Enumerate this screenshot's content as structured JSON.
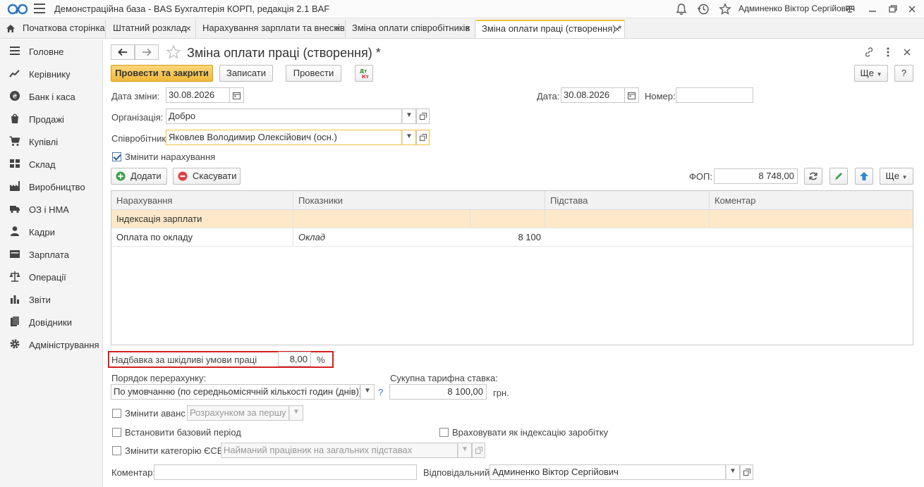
{
  "app": {
    "title": "Демонстраційна база - BAS Бухгалтерія КОРП, редакція 2.1 BAF",
    "user": "Админенко Віктор Сергійович"
  },
  "tabs": [
    {
      "label": "Початкова сторінка"
    },
    {
      "label": "Штатний розклад"
    },
    {
      "label": "Нарахування зарплати та внесків"
    },
    {
      "label": "Зміна оплати співробітників"
    },
    {
      "label": "Зміна оплати праці (створення) *"
    }
  ],
  "sidebar": {
    "items": [
      {
        "label": "Головне",
        "icon": "menu-icon"
      },
      {
        "label": "Керівнику",
        "icon": "trend-icon"
      },
      {
        "label": "Банк і каса",
        "icon": "coin-icon"
      },
      {
        "label": "Продажі",
        "icon": "bag-icon"
      },
      {
        "label": "Купівлі",
        "icon": "cart-icon"
      },
      {
        "label": "Склад",
        "icon": "warehouse-icon"
      },
      {
        "label": "Виробництво",
        "icon": "factory-icon"
      },
      {
        "label": "ОЗ і НМА",
        "icon": "truck-icon"
      },
      {
        "label": "Кадри",
        "icon": "person-icon"
      },
      {
        "label": "Зарплата",
        "icon": "wallet-icon"
      },
      {
        "label": "Операції",
        "icon": "scales-icon"
      },
      {
        "label": "Звіти",
        "icon": "bar-chart-icon"
      },
      {
        "label": "Довідники",
        "icon": "books-icon"
      },
      {
        "label": "Адміністрування",
        "icon": "gear-icon"
      }
    ]
  },
  "form": {
    "title": "Зміна оплати праці (створення) *",
    "buttons": {
      "post_close": "Провести та закрити",
      "save": "Записати",
      "post": "Провести",
      "more": "Ще",
      "help": "?"
    },
    "change_date_label": "Дата зміни:",
    "change_date": "30.08.2026",
    "date_label": "Дата:",
    "date": "30.08.2026",
    "number_label": "Номер:",
    "number": "",
    "org_label": "Організація:",
    "org": "Добро",
    "employee_label": "Співробітник:",
    "employee": "Яковлев Володимир Олексійович (осн.)",
    "change_accruals_label": "Змінити нарахування",
    "add_label": "Додати",
    "cancel_label": "Скасувати",
    "fop_label": "ФОП:",
    "fop": "8 748,00",
    "grid_more": "Ще"
  },
  "grid": {
    "columns": [
      "Нарахування",
      "Показники",
      "Підстава",
      "Коментар"
    ],
    "rows": [
      {
        "accrual": "Індексація зарплати",
        "indicator": "",
        "value": "",
        "basis": "",
        "comment": ""
      },
      {
        "accrual": "Оплата по окладу",
        "indicator": "Оклад",
        "value": "8 100",
        "basis": "",
        "comment": ""
      }
    ]
  },
  "bottom": {
    "hazard_label": "Надбавка за шкідливі умови праці",
    "hazard_value": "8,00",
    "hazard_unit": "%",
    "recalc_label": "Порядок перерахунку:",
    "recalc_value": "По умовчанню (по середньомісячній кількості годин (днів))",
    "recalc_help": "?",
    "total_rate_label": "Сукупна тарифна ставка:",
    "total_rate": "8 100,00",
    "currency": "грн.",
    "advance_label": "Змінити аванс",
    "advance_value": "Розрахунком за першу пол",
    "base_period_label": "Встановити базовий період",
    "indexation_label": "Враховувати як індексацію заробітку",
    "esv_label": "Змінити категорію ЄСВ",
    "esv_value": "Найманий працівник на загальних підставах",
    "comment_label": "Коментар:",
    "comment": "",
    "responsible_label": "Відповідальний:",
    "responsible": "Админенко Віктор Сергійович"
  }
}
